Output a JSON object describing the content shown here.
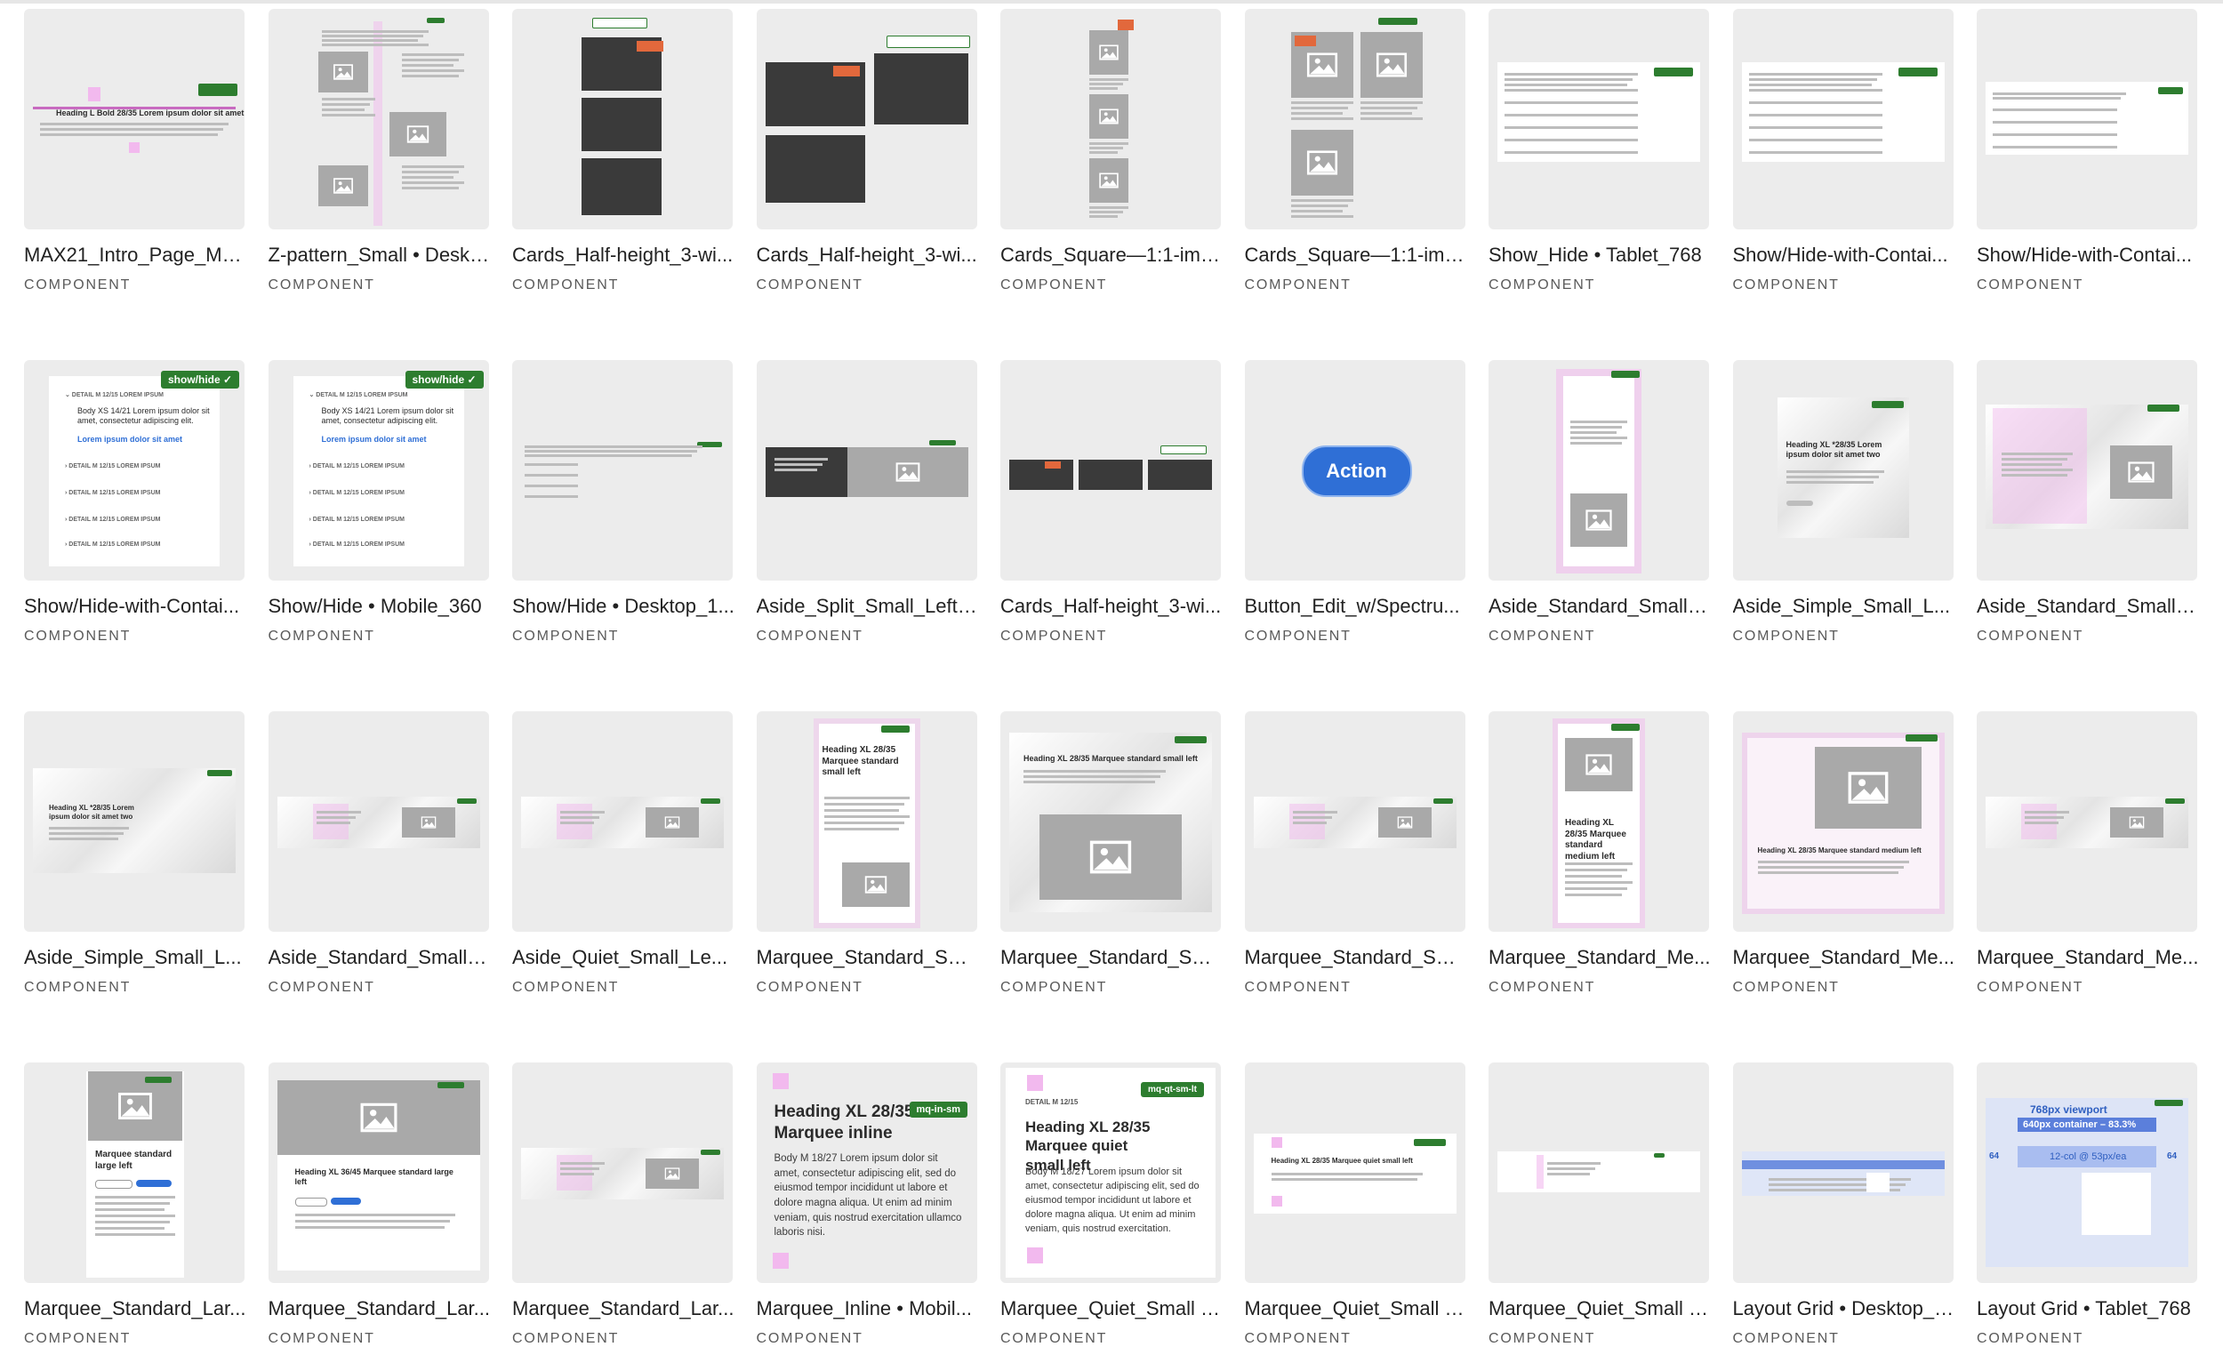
{
  "subtitle": "COMPONENT",
  "items": [
    {
      "title": "MAX21_Intro_Page_Me...",
      "variant": "intro"
    },
    {
      "title": "Z-pattern_Small • Deskt...",
      "variant": "zpattern"
    },
    {
      "title": "Cards_Half-height_3-wi...",
      "variant": "cards3v"
    },
    {
      "title": "Cards_Half-height_3-wi...",
      "variant": "cards3g"
    },
    {
      "title": "Cards_Square—1:1-ima...",
      "variant": "square1"
    },
    {
      "title": "Cards_Square—1:1-ima...",
      "variant": "square3"
    },
    {
      "title": "Show_Hide • Tablet_768",
      "variant": "list"
    },
    {
      "title": "Show/Hide-with-Contai...",
      "variant": "list"
    },
    {
      "title": "Show/Hide-with-Contai...",
      "variant": "listsmall"
    },
    {
      "title": "Show/Hide-with-Contai...",
      "variant": "showhide"
    },
    {
      "title": "Show/Hide • Mobile_360",
      "variant": "showhide"
    },
    {
      "title": "Show/Hide • Desktop_1...",
      "variant": "listtiny"
    },
    {
      "title": "Aside_Split_Small_Left ...",
      "variant": "asidesplit"
    },
    {
      "title": "Cards_Half-height_3-wi...",
      "variant": "cards3row"
    },
    {
      "title": "Button_Edit_w/Spectru...",
      "variant": "button"
    },
    {
      "title": "Aside_Standard_Small •...",
      "variant": "asidetall"
    },
    {
      "title": "Aside_Simple_Small_L...",
      "variant": "asidesimple"
    },
    {
      "title": "Aside_Standard_Small •...",
      "variant": "asidewide"
    },
    {
      "title": "Aside_Simple_Small_L...",
      "variant": "asidesimple2"
    },
    {
      "title": "Aside_Standard_Small •...",
      "variant": "banner"
    },
    {
      "title": "Aside_Quiet_Small_Le...",
      "variant": "banner"
    },
    {
      "title": "Marquee_Standard_Sm...",
      "variant": "marqueetall"
    },
    {
      "title": "Marquee_Standard_Sm...",
      "variant": "marqueewide"
    },
    {
      "title": "Marquee_Standard_Sm...",
      "variant": "banner"
    },
    {
      "title": "Marquee_Standard_Me...",
      "variant": "marqueemed"
    },
    {
      "title": "Marquee_Standard_Me...",
      "variant": "marqueemedwide"
    },
    {
      "title": "Marquee_Standard_Me...",
      "variant": "banner"
    },
    {
      "title": "Marquee_Standard_Lar...",
      "variant": "marqueelarge"
    },
    {
      "title": "Marquee_Standard_Lar...",
      "variant": "marqueelargewide"
    },
    {
      "title": "Marquee_Standard_Lar...",
      "variant": "banner"
    },
    {
      "title": "Marquee_Inline • Mobil...",
      "variant": "inline"
    },
    {
      "title": "Marquee_Quiet_Small •...",
      "variant": "quiet"
    },
    {
      "title": "Marquee_Quiet_Small •...",
      "variant": "quietsmall"
    },
    {
      "title": "Marquee_Quiet_Small •...",
      "variant": "quietstrip"
    },
    {
      "title": "Layout Grid • Desktop_1...",
      "variant": "layoutdesk"
    },
    {
      "title": "Layout Grid • Tablet_768",
      "variant": "layouttab"
    }
  ],
  "thumb_text": {
    "action": "Action",
    "show_hide": "show/hide",
    "detail": "DETAIL M 12/15 LOREM IPSUM",
    "body_xs": "Body XS 14/21 Lorem ipsum dolor sit amet, consectetur adipiscing elit.",
    "link": "Lorem ipsum dolor sit amet",
    "inline_heading": "Heading XL 28/35 Marquee inline",
    "inline_tag": "mq-in-sm",
    "inline_body": "Body M 18/27 Lorem ipsum dolor sit amet, consectetur adipiscing elit, sed do eiusmod tempor incididunt ut labore et dolore magna aliqua. Ut enim ad minim veniam, quis nostrud exercitation ullamco laboris nisi.",
    "quiet_detail": "DETAIL M 12/15",
    "quiet_heading": "Heading XL 28/35 Marquee quiet small left",
    "quiet_tag": "mq-qt-sm-lt",
    "quiet_body": "Body M 18/27 Lorem ipsum dolor sit amet, consectetur adipiscing elit, sed do eiusmod tempor incididunt ut labore et dolore magna aliqua. Ut enim ad minim veniam, quis nostrud exercitation.",
    "grid_viewport": "768px viewport",
    "grid_container": "640px container – 83.3%",
    "grid_col": "12-col @ 53px/ea",
    "grid_margin": "64",
    "marquee_heading": "Heading XL 28/35 Marquee standard small left",
    "marquee_large": "Marquee standard large left"
  }
}
